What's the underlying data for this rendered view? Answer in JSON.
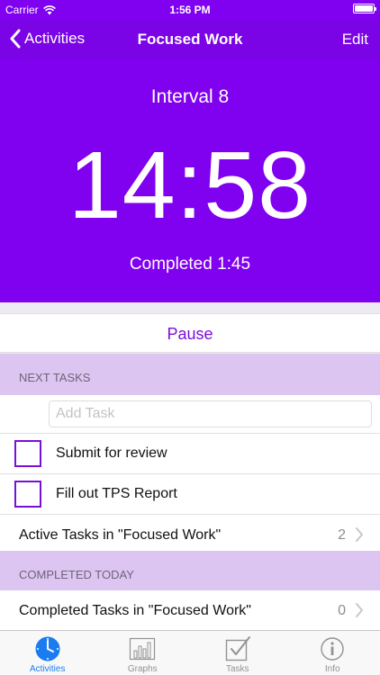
{
  "status_bar": {
    "carrier": "Carrier",
    "time": "1:56 PM",
    "battery_level": 1.0
  },
  "nav": {
    "back_label": "Activities",
    "title": "Focused Work",
    "edit_label": "Edit"
  },
  "timer": {
    "interval": "Interval 8",
    "remaining": "14:58",
    "completed": "Completed 1:45"
  },
  "pause_label": "Pause",
  "next_tasks": {
    "header": "NEXT TASKS",
    "add_placeholder": "Add Task",
    "tasks": [
      {
        "label": "Submit for review",
        "checked": false
      },
      {
        "label": "Fill out TPS Report",
        "checked": false
      }
    ],
    "active_link": {
      "label": "Active Tasks in \"Focused Work\"",
      "count": "2"
    }
  },
  "completed_today": {
    "header": "COMPLETED TODAY",
    "completed_link": {
      "label": "Completed Tasks in \"Focused Work\"",
      "count": "0"
    }
  },
  "tabs": [
    {
      "label": "Activities",
      "icon": "clock-icon",
      "active": true
    },
    {
      "label": "Graphs",
      "icon": "bar-chart-icon",
      "active": false
    },
    {
      "label": "Tasks",
      "icon": "checkmark-box-icon",
      "active": false
    },
    {
      "label": "Info",
      "icon": "info-icon",
      "active": false
    }
  ],
  "colors": {
    "accent": "#8000f0",
    "section": "#ddc5f2",
    "tab_active": "#1a7cf0",
    "tab_inactive": "#929292"
  }
}
